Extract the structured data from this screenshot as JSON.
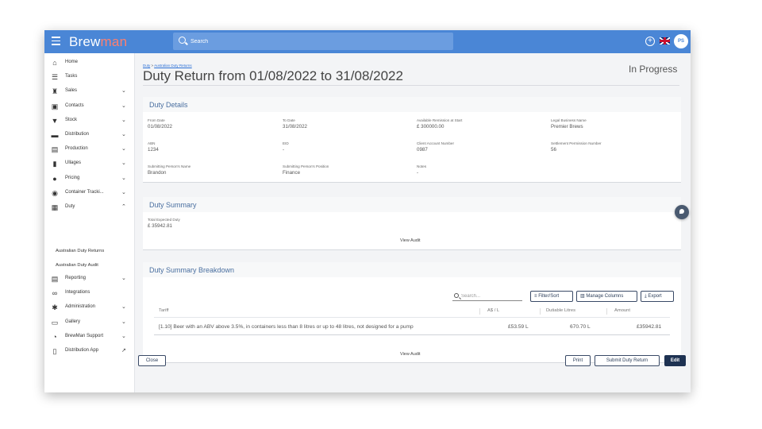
{
  "app": {
    "logo_part1": "Brew",
    "logo_part2": "man",
    "search_placeholder": "Search",
    "user_initials": "PS",
    "plus_icon": "+",
    "flag": "uk-flag-icon",
    "accent_color": "#4a86d6"
  },
  "sidebar": {
    "items": [
      {
        "label": "Home",
        "icon": "home-icon",
        "glyph": "⌂",
        "chevron": ""
      },
      {
        "label": "Tasks",
        "icon": "list-icon",
        "glyph": "☰",
        "chevron": ""
      },
      {
        "label": "Sales",
        "icon": "basket-icon",
        "glyph": "♜",
        "chevron": "⌄"
      },
      {
        "label": "Contacts",
        "icon": "contacts-icon",
        "glyph": "▣",
        "chevron": "⌄"
      },
      {
        "label": "Stock",
        "icon": "funnel-icon",
        "glyph": "▼",
        "chevron": "⌄"
      },
      {
        "label": "Distribution",
        "icon": "truck-icon",
        "glyph": "▬",
        "chevron": "⌄"
      },
      {
        "label": "Production",
        "icon": "production-icon",
        "glyph": "▤",
        "chevron": "⌄"
      },
      {
        "label": "Ullages",
        "icon": "bottle-icon",
        "glyph": "▮",
        "chevron": "⌄"
      },
      {
        "label": "Pricing",
        "icon": "pricing-icon",
        "glyph": "●",
        "chevron": "⌄"
      },
      {
        "label": "Container Tracki...",
        "icon": "target-icon",
        "glyph": "◉",
        "chevron": "⌄"
      },
      {
        "label": "Duty",
        "icon": "duty-icon",
        "glyph": "▦",
        "chevron": "⌃"
      }
    ],
    "duty_sub": [
      "Australian Duty Returns",
      "Australian Duty Audit"
    ],
    "items_after": [
      {
        "label": "Reporting",
        "icon": "report-icon",
        "glyph": "▤",
        "chevron": "⌄"
      },
      {
        "label": "Integrations",
        "icon": "link-icon",
        "glyph": "∞",
        "chevron": ""
      },
      {
        "label": "Administration",
        "icon": "gear-icon",
        "glyph": "✱",
        "chevron": "⌄"
      },
      {
        "label": "Gallery",
        "icon": "image-icon",
        "glyph": "▭",
        "chevron": "⌄"
      },
      {
        "label": "BrewMan Support",
        "icon": "support-icon",
        "glyph": "◔",
        "chevron": "⌄"
      },
      {
        "label": "Distribution App",
        "icon": "phone-icon",
        "glyph": "▯",
        "chevron": "↗"
      }
    ]
  },
  "page": {
    "breadcrumb_root": "Duty",
    "breadcrumb_sep": " > ",
    "breadcrumb_current": "Australian Duty Returns",
    "title": "Duty Return from 01/08/2022 to 31/08/2022",
    "status": "In Progress"
  },
  "details": {
    "title": "Duty Details",
    "fields": [
      {
        "label": "From Date",
        "value": "01/08/2022"
      },
      {
        "label": "To Date",
        "value": "31/08/2022"
      },
      {
        "label": "Available Remission at Start",
        "value": "£ 300000.00"
      },
      {
        "label": "Legal Business Name",
        "value": "Premier Brews"
      },
      {
        "label": "ABN",
        "value": "1234"
      },
      {
        "label": "EID",
        "value": "-"
      },
      {
        "label": "Client Account Number",
        "value": "0987"
      },
      {
        "label": "Settlement Permission Number",
        "value": "56"
      },
      {
        "label": "Submitting Person's Name",
        "value": "Brandon"
      },
      {
        "label": "Submitting Person's Position",
        "value": "Finance"
      },
      {
        "label": "Notes",
        "value": "-"
      }
    ]
  },
  "summary": {
    "title": "Duty Summary",
    "total_label": "Total Expected Duty",
    "total_value": "£ 35942.81",
    "view_audit": "View Audit"
  },
  "breakdown": {
    "title": "Duty Summary Breakdown",
    "search_placeholder": "Search...",
    "filter_label": "Filter/Sort",
    "manage_label": "Manage Columns",
    "export_label": "Export",
    "columns": [
      "Tariff",
      "A$ / L",
      "Dutiable Litres",
      "Amount"
    ],
    "rows": [
      {
        "tariff": "[1.10] Beer with an ABV above 3.5%, in containers less than 8 litres or up to 48 litres, not designed for a pump",
        "rate": "£53.59 L",
        "litres": "670.70 L",
        "amount": "£35942.81"
      }
    ],
    "view_audit": "View Audit"
  },
  "footer": {
    "close": "Close",
    "print": "Print",
    "submit": "Submit Duty Return",
    "edit": "Edit"
  }
}
